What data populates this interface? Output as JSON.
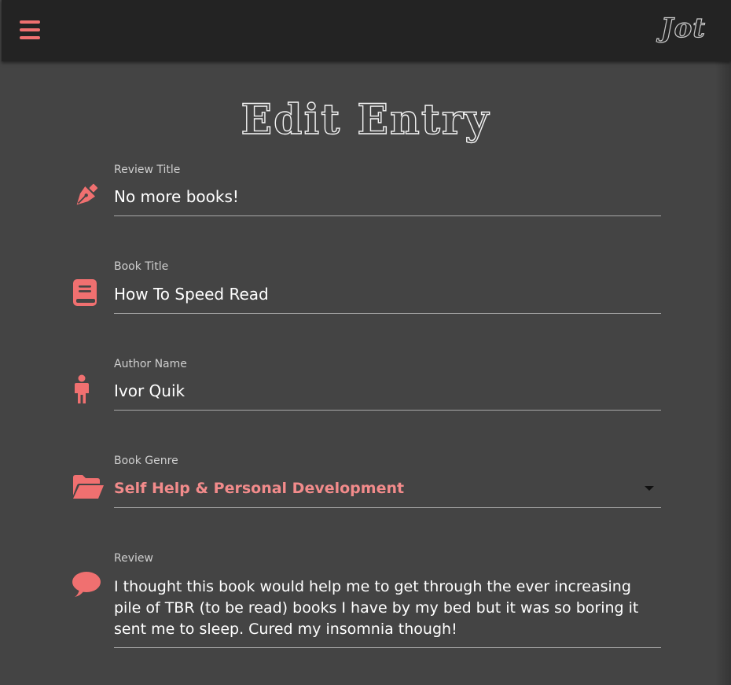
{
  "app": {
    "brand": "Jot"
  },
  "page": {
    "title": "Edit Entry"
  },
  "form": {
    "review_title": {
      "label": "Review Title",
      "value": "No more books!",
      "icon": "pen-nib-icon"
    },
    "book_title": {
      "label": "Book Title",
      "value": "How To Speed Read",
      "icon": "book-icon"
    },
    "author_name": {
      "label": "Author Name",
      "value": "Ivor Quik",
      "icon": "person-icon"
    },
    "book_genre": {
      "label": "Book Genre",
      "value": "Self Help & Personal Development",
      "icon": "folder-open-icon"
    },
    "review": {
      "label": "Review",
      "value": "I thought this book would help me to get through the ever increasing pile of TBR (to be read) books I have by my bed but it was so boring it sent me to sleep. Cured my insomnia though!",
      "icon": "comment-icon"
    }
  },
  "colors": {
    "accent": "#f07070",
    "navbar": "#232323",
    "background": "#444444"
  }
}
